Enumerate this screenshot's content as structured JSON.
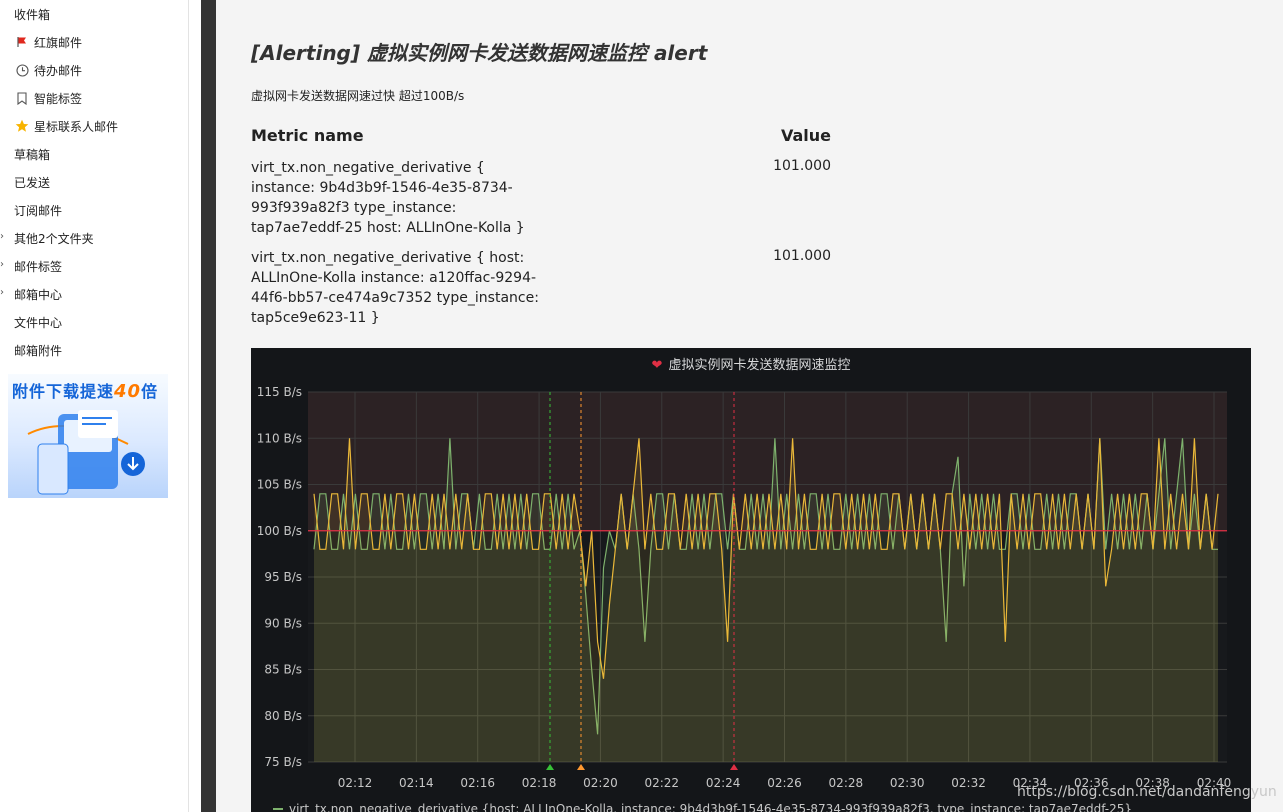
{
  "sidebar": {
    "items": [
      {
        "label": "收件箱",
        "icon": ""
      },
      {
        "label": "红旗邮件",
        "icon": "red-flag-icon"
      },
      {
        "label": "待办邮件",
        "icon": "clock-icon"
      },
      {
        "label": "智能标签",
        "icon": "bookmark-icon"
      },
      {
        "label": "星标联系人邮件",
        "icon": "star-icon"
      },
      {
        "label": "草稿箱",
        "icon": ""
      },
      {
        "label": "已发送",
        "icon": ""
      },
      {
        "label": "订阅邮件",
        "icon": ""
      },
      {
        "label": "其他2个文件夹",
        "icon": "",
        "expandable": true
      },
      {
        "label": "邮件标签",
        "icon": "",
        "expandable": true
      },
      {
        "label": "邮箱中心",
        "icon": "",
        "expandable": true
      },
      {
        "label": "文件中心",
        "icon": ""
      },
      {
        "label": "邮箱附件",
        "icon": ""
      }
    ],
    "promo": {
      "text_a": "附件下载提速",
      "text_num": "40",
      "text_b": "倍"
    }
  },
  "email": {
    "title": "[Alerting] 虚拟实例网卡发送数据网速监控 alert",
    "message": "虚拟网卡发送数据网速过快 超过100B/s",
    "metric_header": "Metric name",
    "value_header": "Value",
    "metrics": [
      {
        "name": "virt_tx.non_negative_derivative { instance: 9b4d3b9f-1546-4e35-8734-993f939a82f3 type_instance: tap7ae7eddf-25 host: ALLInOne-Kolla }",
        "value": "101.000"
      },
      {
        "name": "virt_tx.non_negative_derivative { host: ALLInOne-Kolla instance: a120ffac-9294-44f6-bb57-ce474a9c7352 type_instance: tap5ce9e623-11 }",
        "value": "101.000"
      }
    ]
  },
  "chart_data": {
    "type": "line",
    "title": "虚拟实例网卡发送数据网速监控",
    "ylim": [
      75,
      115
    ],
    "yticks": [
      "75 B/s",
      "80 B/s",
      "85 B/s",
      "90 B/s",
      "95 B/s",
      "100 B/s",
      "105 B/s",
      "110 B/s",
      "115 B/s"
    ],
    "xticks": [
      "02:12",
      "02:14",
      "02:16",
      "02:18",
      "02:20",
      "02:22",
      "02:24",
      "02:26",
      "02:28",
      "02:30",
      "02:32",
      "02:34",
      "02:36",
      "02:38",
      "02:40"
    ],
    "threshold": 100,
    "grid": true,
    "legend_text": "virt_tx.non_negative_derivative {host: ALLInOne-Kolla, instance: 9b4d3b9f-1546-4e35-8734-993f939a82f3, type_instance: tap7ae7eddf-25}",
    "series": [
      {
        "color": "#7eb26d",
        "values": [
          98,
          104,
          104,
          98,
          98,
          104,
          98,
          104,
          98,
          98,
          104,
          104,
          98,
          104,
          98,
          98,
          104,
          98,
          104,
          104,
          98,
          104,
          98,
          110,
          98,
          104,
          104,
          98,
          104,
          98,
          98,
          104,
          98,
          104,
          98,
          104,
          98,
          104,
          104,
          98,
          98,
          104,
          98,
          104,
          98,
          100,
          93,
          85,
          78,
          96,
          100,
          98,
          104,
          98,
          104,
          98,
          88,
          98,
          104,
          104,
          98,
          104,
          98,
          98,
          104,
          98,
          104,
          98,
          104,
          104,
          98,
          104,
          98,
          98,
          104,
          98,
          104,
          98,
          110,
          98,
          104,
          98,
          104,
          98,
          104,
          104,
          98,
          104,
          98,
          98,
          104,
          98,
          104,
          98,
          104,
          98,
          104,
          104,
          98,
          104,
          98,
          104,
          98,
          104,
          98,
          104,
          98,
          88,
          104,
          108,
          94,
          104,
          98,
          104,
          98,
          104,
          98,
          98,
          104,
          104,
          98,
          104,
          98,
          98,
          104,
          98,
          104,
          98,
          104,
          104,
          98,
          104,
          98,
          110,
          98,
          104,
          98,
          104,
          98,
          104,
          98,
          104,
          98,
          104,
          110,
          98,
          104,
          110,
          98,
          104,
          98,
          104,
          98,
          98
        ]
      },
      {
        "color": "#eab839",
        "values": [
          104,
          98,
          98,
          104,
          104,
          98,
          110,
          98,
          104,
          104,
          98,
          98,
          104,
          98,
          104,
          104,
          98,
          104,
          98,
          98,
          104,
          98,
          104,
          98,
          104,
          98,
          104,
          98,
          98,
          104,
          104,
          98,
          104,
          98,
          104,
          98,
          104,
          98,
          98,
          104,
          104,
          98,
          104,
          98,
          104,
          100,
          94,
          100,
          88,
          84,
          92,
          98,
          104,
          98,
          104,
          110,
          98,
          104,
          98,
          98,
          104,
          104,
          98,
          104,
          98,
          104,
          98,
          104,
          104,
          98,
          88,
          104,
          98,
          104,
          98,
          104,
          98,
          104,
          98,
          104,
          98,
          110,
          98,
          104,
          98,
          98,
          104,
          98,
          104,
          104,
          98,
          104,
          98,
          104,
          98,
          104,
          98,
          98,
          104,
          104,
          98,
          104,
          98,
          104,
          98,
          104,
          98,
          104,
          104,
          98,
          104,
          98,
          104,
          98,
          104,
          98,
          104,
          88,
          104,
          98,
          104,
          98,
          104,
          104,
          98,
          104,
          98,
          104,
          98,
          104,
          98,
          104,
          98,
          110,
          94,
          98,
          104,
          98,
          104,
          98,
          104,
          104,
          98,
          110,
          98,
          104,
          98,
          104,
          98,
          110,
          98,
          104,
          98,
          104
        ]
      }
    ],
    "annotations": [
      {
        "time": "02:18:20",
        "color": "#37c037"
      },
      {
        "time": "02:19:20",
        "color": "#ff9830"
      },
      {
        "time": "02:24:20",
        "color": "#e02f44"
      }
    ]
  },
  "watermark": "https://blog.csdn.net/dandanfengyun"
}
